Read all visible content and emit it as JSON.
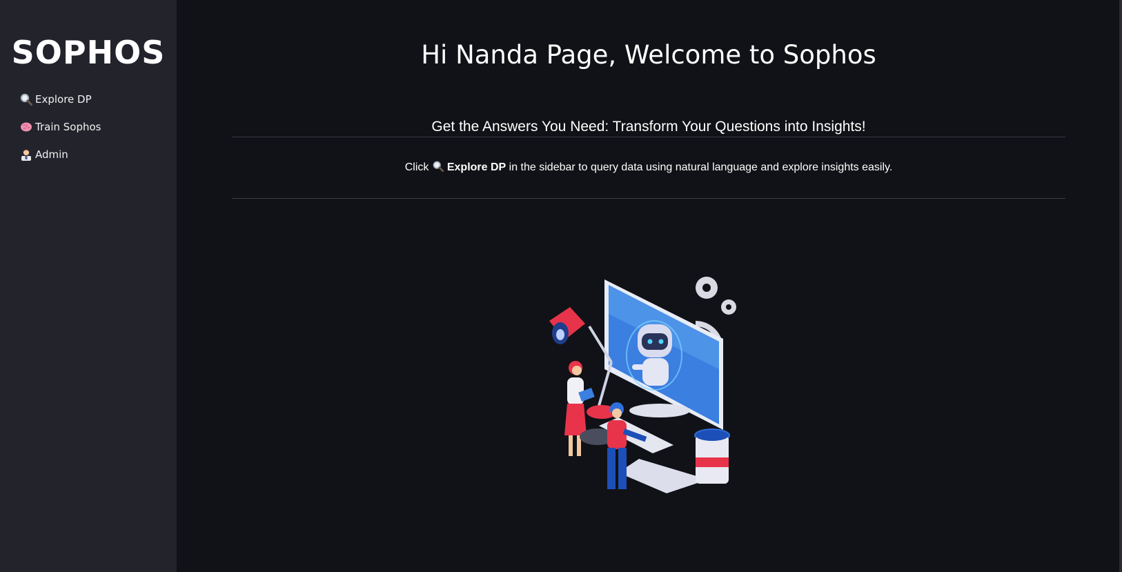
{
  "sidebar": {
    "brand": "SOPHOS",
    "items": [
      {
        "label": "Explore DP",
        "icon": "magnifier-icon"
      },
      {
        "label": "Train Sophos",
        "icon": "brain-icon"
      },
      {
        "label": "Admin",
        "icon": "admin-person-icon"
      }
    ]
  },
  "main": {
    "title": "Hi Nanda Page, Welcome to Sophos",
    "subtitle": "Get the Answers You Need: Transform Your Questions into Insights!",
    "hint": {
      "prefix": "Click",
      "highlight": "Explore DP",
      "suffix": "in the sidebar to query data using natural language and explore insights easily."
    },
    "illustration": "robot-computer-people-illustration"
  },
  "colors": {
    "background": "#111217",
    "sidebar": "#22232b",
    "divider": "#3a3b44",
    "accent_red": "#e8344a",
    "accent_blue": "#2f6fdc"
  }
}
